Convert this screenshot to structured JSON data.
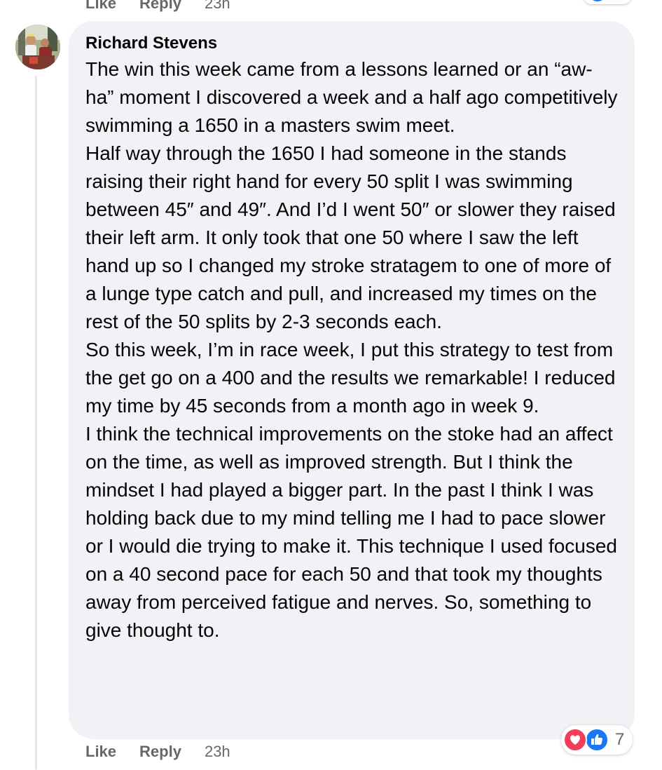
{
  "previous_comment": {
    "like_label": "Like",
    "reply_label": "Reply",
    "time": "23h"
  },
  "comment": {
    "author": "Richard Stevens",
    "paragraphs": [
      "The win this week came from a lessons learned or an “aw-ha” moment I discovered a week and a half ago competitively swimming a 1650 in a masters swim meet.",
      "Half way through the 1650 I had someone in the stands raising their right hand for every 50 split I was swimming between 45″ and 49″. And I’d I went 50″ or slower they raised their left arm. It only took that one 50 where I saw the left hand up so I changed my stroke stratagem to one of more of a lunge type catch and pull, and increased my times on the rest of the 50 splits by 2-3 seconds each.",
      "So this week, I’m in race week, I put this strategy to test from the get go on a 400 and the results we remarkable! I reduced my time by 45 seconds from a month ago in week 9.",
      "I think the technical improvements on the stoke had an affect on the time, as well as improved strength. But I think the mindset I had played a bigger part. In the past I think I was holding back due to my mind telling me I had to pace slower or I would die trying to make it. This technique I used focused on a 40 second pace for each 50 and that took my thoughts away from perceived fatigue and nerves. So, something to give thought to."
    ],
    "like_label": "Like",
    "reply_label": "Reply",
    "time": "23h",
    "reaction_icons": [
      "love-icon",
      "like-icon"
    ],
    "reaction_count": "7"
  },
  "colors": {
    "bubble": "#f0f2f5",
    "meta_text": "#65676b",
    "like_blue": "#1877f2",
    "love_red": "#f33e58"
  }
}
